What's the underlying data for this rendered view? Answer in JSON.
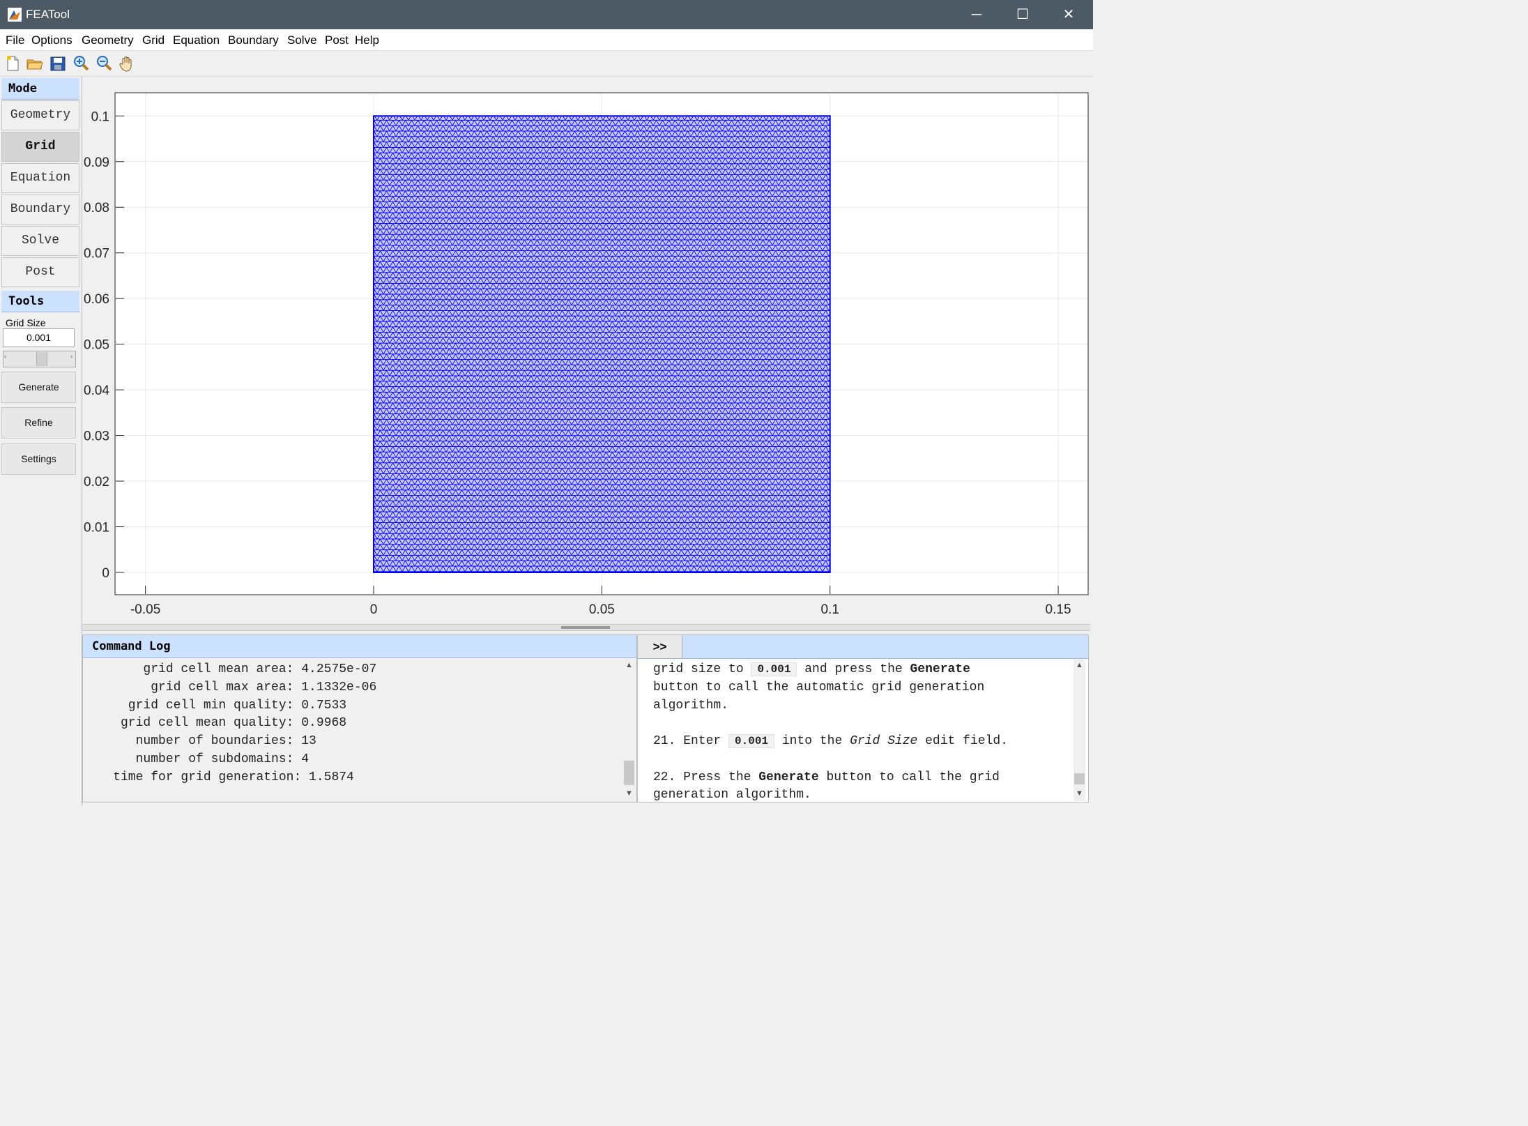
{
  "window": {
    "title": "FEATool",
    "minimize": "─",
    "maximize": "☐",
    "close": "✕"
  },
  "menu": [
    "File",
    "Options",
    "Geometry",
    "Grid",
    "Equation",
    "Boundary",
    "Solve",
    "Post",
    "Help"
  ],
  "toolbar": [
    "new-file-icon",
    "open-folder-icon",
    "save-icon",
    "zoom-in-icon",
    "zoom-out-icon",
    "pan-hand-icon"
  ],
  "sidebar": {
    "mode_header": "Mode",
    "modes": [
      "Geometry",
      "Grid",
      "Equation",
      "Boundary",
      "Solve",
      "Post"
    ],
    "active_mode": "Grid",
    "tools_header": "Tools",
    "grid_size_label": "Grid Size",
    "grid_size_value": "0.001",
    "buttons": [
      "Generate",
      "Refine",
      "Settings"
    ]
  },
  "plot": {
    "x_ticks": [
      "-0.05",
      "0",
      "0.05",
      "0.1",
      "0.15"
    ],
    "y_ticks": [
      "0",
      "0.01",
      "0.02",
      "0.03",
      "0.04",
      "0.05",
      "0.06",
      "0.07",
      "0.08",
      "0.09",
      "0.1"
    ],
    "mesh_color": "#0000ff",
    "domain": {
      "x": [
        0,
        0.1
      ],
      "y": [
        0,
        0.1
      ]
    }
  },
  "command_log": {
    "title": "Command Log",
    "lines": [
      "        grid cell mean area: 4.2575e-07",
      "         grid cell max area: 1.1332e-06",
      "      grid cell min quality: 0.7533",
      "     grid cell mean quality: 0.9968",
      "       number of boundaries: 13",
      "       number of subdomains: 4",
      "    time for grid generation: 1.5874"
    ]
  },
  "help": {
    "expand_label": ">>",
    "line1_a": "grid size to ",
    "line1_code": "0.001",
    "line1_b": " and press the ",
    "line1_bold": "Generate",
    "line2": "button to call the automatic grid generation",
    "line3": "algorithm.",
    "line4_a": "21. Enter ",
    "line4_code": "0.001",
    "line4_b": " into the ",
    "line4_ital": "Grid Size",
    "line4_c": " edit field.",
    "line5_a": "22. Press the ",
    "line5_bold": "Generate",
    "line5_b": " button to call the grid",
    "line6": "generation algorithm."
  },
  "colors": {
    "header_bg": "#cbe1fd",
    "titlebar_bg": "#4d5a66",
    "mesh": "#0000ff"
  }
}
